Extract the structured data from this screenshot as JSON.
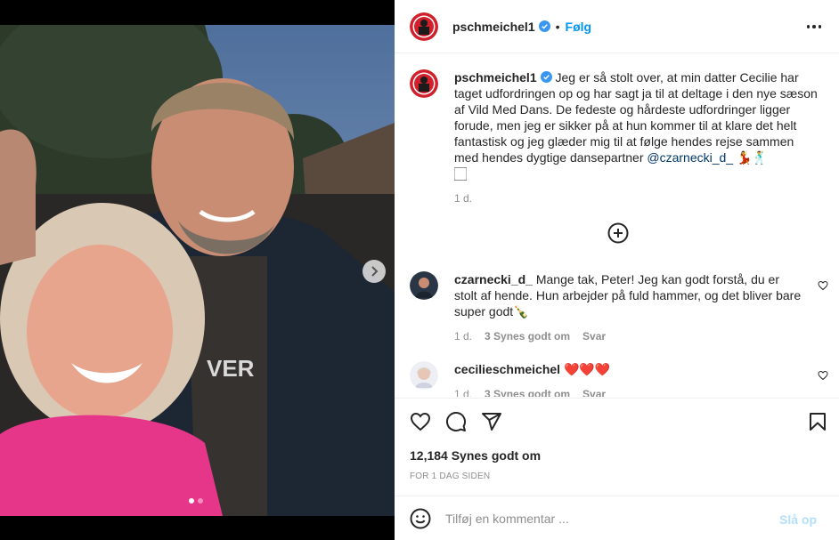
{
  "post": {
    "username": "pschmeichel1",
    "follow_label": "Følg",
    "separator": "•"
  },
  "caption": {
    "username": "pschmeichel1",
    "text_part1": "Jeg er så stolt over, at min datter Cecilie har taget udfordringen op og har sagt ja til at deltage i den nye sæson af Vild Med Dans. De fedeste og hårdeste udfordringer ligger forude, men jeg er sikker på at hun kommer til at klare det helt fantastisk og jeg glæder mig til at følge hendes rejse sammen med hendes dygtige dansepartner ",
    "mention": "@czarnecki_d_",
    "emoji_tail": " 💃🕺",
    "emoji_line2": "🏻",
    "time": "1 d."
  },
  "comments": [
    {
      "username": "czarnecki_d_",
      "text": "Mange tak, Peter! Jeg kan godt forstå, du er stolt af hende. Hun arbejder på fuld hammer, og det bliver bare super godt🍾",
      "time": "1 d.",
      "likes": "3 Synes godt om",
      "reply": "Svar"
    },
    {
      "username": "cecilieschmeichel",
      "text": "❤️❤️❤️",
      "time": "1 d.",
      "likes": "3 Synes godt om",
      "reply": "Svar"
    }
  ],
  "stats": {
    "likes": "12,184 Synes godt om",
    "ago": "FOR 1 DAG SIDEN"
  },
  "compose": {
    "placeholder": "Tilføj en kommentar ...",
    "post_label": "Slå op"
  },
  "colors": {
    "accent": "#0095f6",
    "muted": "#8e8e8e",
    "link": "#00376b",
    "heart_red": "#ed4956"
  },
  "icons": [
    "verified-badge-icon",
    "more-options-icon",
    "add-circle-icon",
    "heart-icon",
    "comment-icon",
    "share-icon",
    "bookmark-icon",
    "emoji-icon",
    "chevron-right-icon"
  ]
}
